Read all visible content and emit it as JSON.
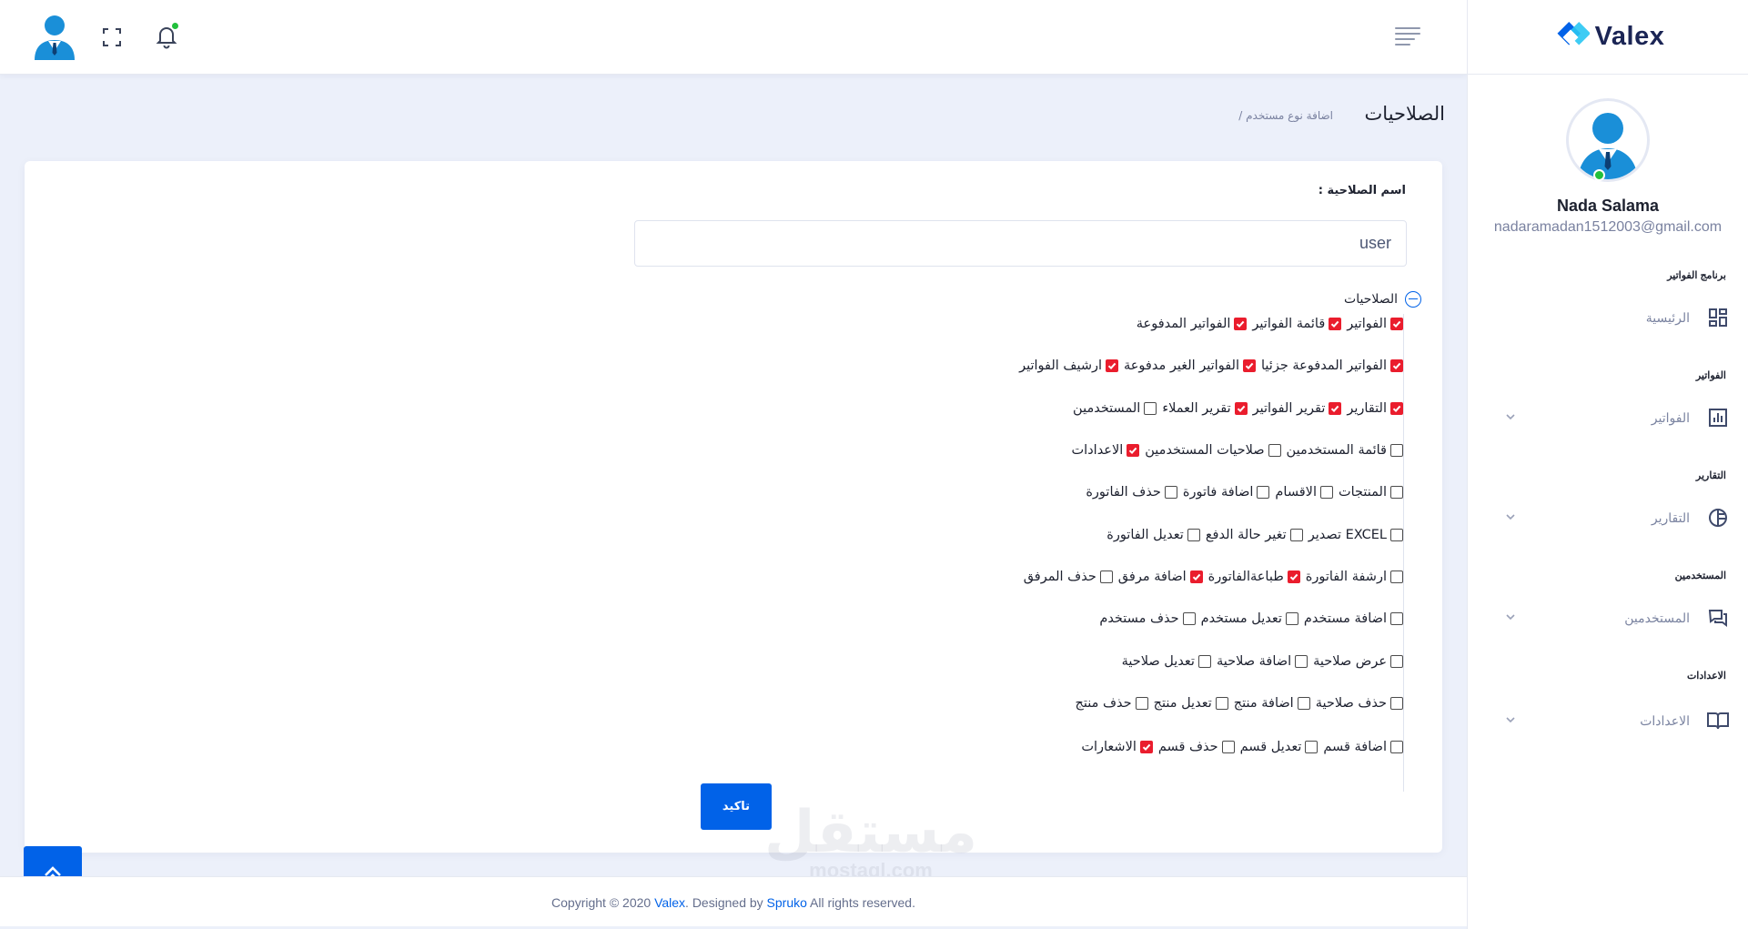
{
  "header": {
    "avatar_icon": "user-avatar-icon",
    "expand_icon": "fullscreen-icon",
    "notification_icon": "bell-icon",
    "menu_icon": "menu-icon"
  },
  "sidebar": {
    "logo_text": "Valex",
    "user": {
      "name": "Nada Salama",
      "email": "nadaramadan1512003@gmail.com"
    },
    "sections": [
      {
        "category": "برنامج الفواتير",
        "item": "الرئيسية",
        "icon": "dashboard-icon",
        "has_chevron": false
      },
      {
        "category": "الفواتير",
        "item": "الفواتير",
        "icon": "bar-chart-icon",
        "has_chevron": true
      },
      {
        "category": "التقارير",
        "item": "التقارير",
        "icon": "pie-chart-icon",
        "has_chevron": true
      },
      {
        "category": "المستخدمين",
        "item": "المستخدمين",
        "icon": "chat-icon",
        "has_chevron": true
      },
      {
        "category": "الاعدادات",
        "item": "الاعدادات",
        "icon": "book-icon",
        "has_chevron": true
      }
    ]
  },
  "page": {
    "title": "الصلاحيات",
    "breadcrumb": "/ اضافة نوع مستخدم"
  },
  "form": {
    "name_label": "اسم الصلاحية :",
    "name_value": "user",
    "permissions_heading": "الصلاحيات",
    "permissions": [
      [
        {
          "label": "الفواتير",
          "checked": true
        },
        {
          "label": "قائمة الفواتير",
          "checked": true
        },
        {
          "label": "الفواتير المدفوعة",
          "checked": true
        }
      ],
      [
        {
          "label": "الفواتير المدفوعة جزئيا",
          "checked": true
        },
        {
          "label": "الفواتير الغير مدفوعة",
          "checked": true
        },
        {
          "label": "ارشيف الفواتير",
          "checked": true
        }
      ],
      [
        {
          "label": "التقارير",
          "checked": true
        },
        {
          "label": "تقرير الفواتير",
          "checked": true
        },
        {
          "label": "تقرير العملاء",
          "checked": true
        },
        {
          "label": "المستخدمين",
          "checked": false
        }
      ],
      [
        {
          "label": "قائمة المستخدمين",
          "checked": false
        },
        {
          "label": "صلاحيات المستخدمين",
          "checked": false
        },
        {
          "label": "الاعدادات",
          "checked": true
        }
      ],
      [
        {
          "label": "المنتجات",
          "checked": false
        },
        {
          "label": "الاقسام",
          "checked": false
        },
        {
          "label": "اضافة فاتورة",
          "checked": false
        },
        {
          "label": "حذف الفاتورة",
          "checked": false
        }
      ],
      [
        {
          "label": "تصدير EXCEL",
          "checked": false
        },
        {
          "label": "تغير حالة الدفع",
          "checked": false
        },
        {
          "label": "تعديل الفاتورة",
          "checked": false
        }
      ],
      [
        {
          "label": "ارشفة الفاتورة",
          "checked": false
        },
        {
          "label": "طباعةالفاتورة",
          "checked": true
        },
        {
          "label": "اضافة مرفق",
          "checked": true
        },
        {
          "label": "حذف المرفق",
          "checked": false
        }
      ],
      [
        {
          "label": "اضافة مستخدم",
          "checked": false
        },
        {
          "label": "تعديل مستخدم",
          "checked": false
        },
        {
          "label": "حذف مستخدم",
          "checked": false
        }
      ],
      [
        {
          "label": "عرض صلاحية",
          "checked": false
        },
        {
          "label": "اضافة صلاحية",
          "checked": false
        },
        {
          "label": "تعديل صلاحية",
          "checked": false
        }
      ],
      [
        {
          "label": "حذف صلاحية",
          "checked": false
        },
        {
          "label": "اضافة منتج",
          "checked": false
        },
        {
          "label": "تعديل منتج",
          "checked": false
        },
        {
          "label": "حذف منتج",
          "checked": false
        }
      ],
      [
        {
          "label": "اضافة قسم",
          "checked": false
        },
        {
          "label": "تعديل قسم",
          "checked": false
        },
        {
          "label": "حذف قسم",
          "checked": false
        },
        {
          "label": "الاشعارات",
          "checked": true
        }
      ]
    ],
    "submit_label": "تاكيد"
  },
  "footer": {
    "prefix": "Copyright © 2020 ",
    "brand": "Valex",
    "middle": ". Designed by ",
    "designer": "Spruko",
    "suffix": " All rights reserved."
  },
  "watermark": {
    "arabic": "مستقل",
    "latin": "mostaql.com"
  },
  "colors": {
    "primary": "#0162e8",
    "checked": "#ea1d2d",
    "online": "#22c03c"
  }
}
